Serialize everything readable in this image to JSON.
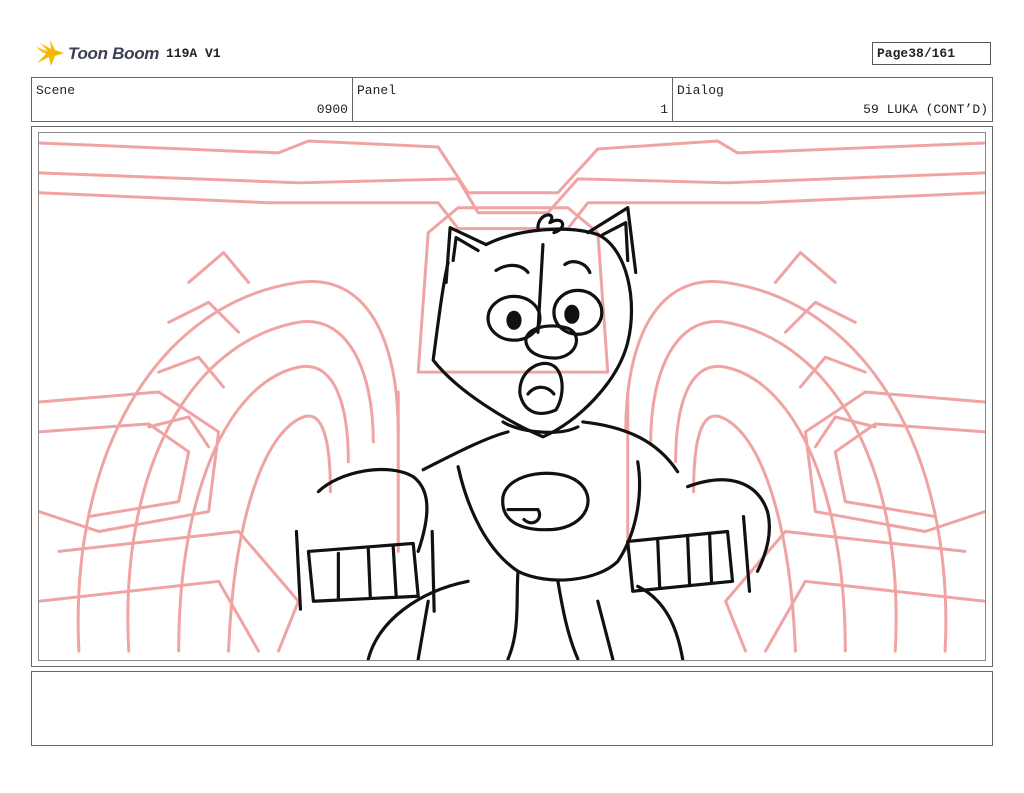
{
  "brand": {
    "name": "Toon Boom",
    "logo_icon": "toon-boom-star-icon",
    "logo_color": "#f5b800",
    "text_color": "#3b3f52"
  },
  "header": {
    "version": "119A V1",
    "page_label": "Page",
    "page_value": "38/161"
  },
  "info": {
    "scene_label": "Scene",
    "scene_value": "0900",
    "panel_label": "Panel",
    "panel_value": "1",
    "dialog_label": "Dialog",
    "dialog_value": "59 LUKA (CONT’D)"
  },
  "colors": {
    "background_sketch": "#f0a3a3",
    "character_ink": "#111111"
  },
  "notes": {
    "text": ""
  }
}
